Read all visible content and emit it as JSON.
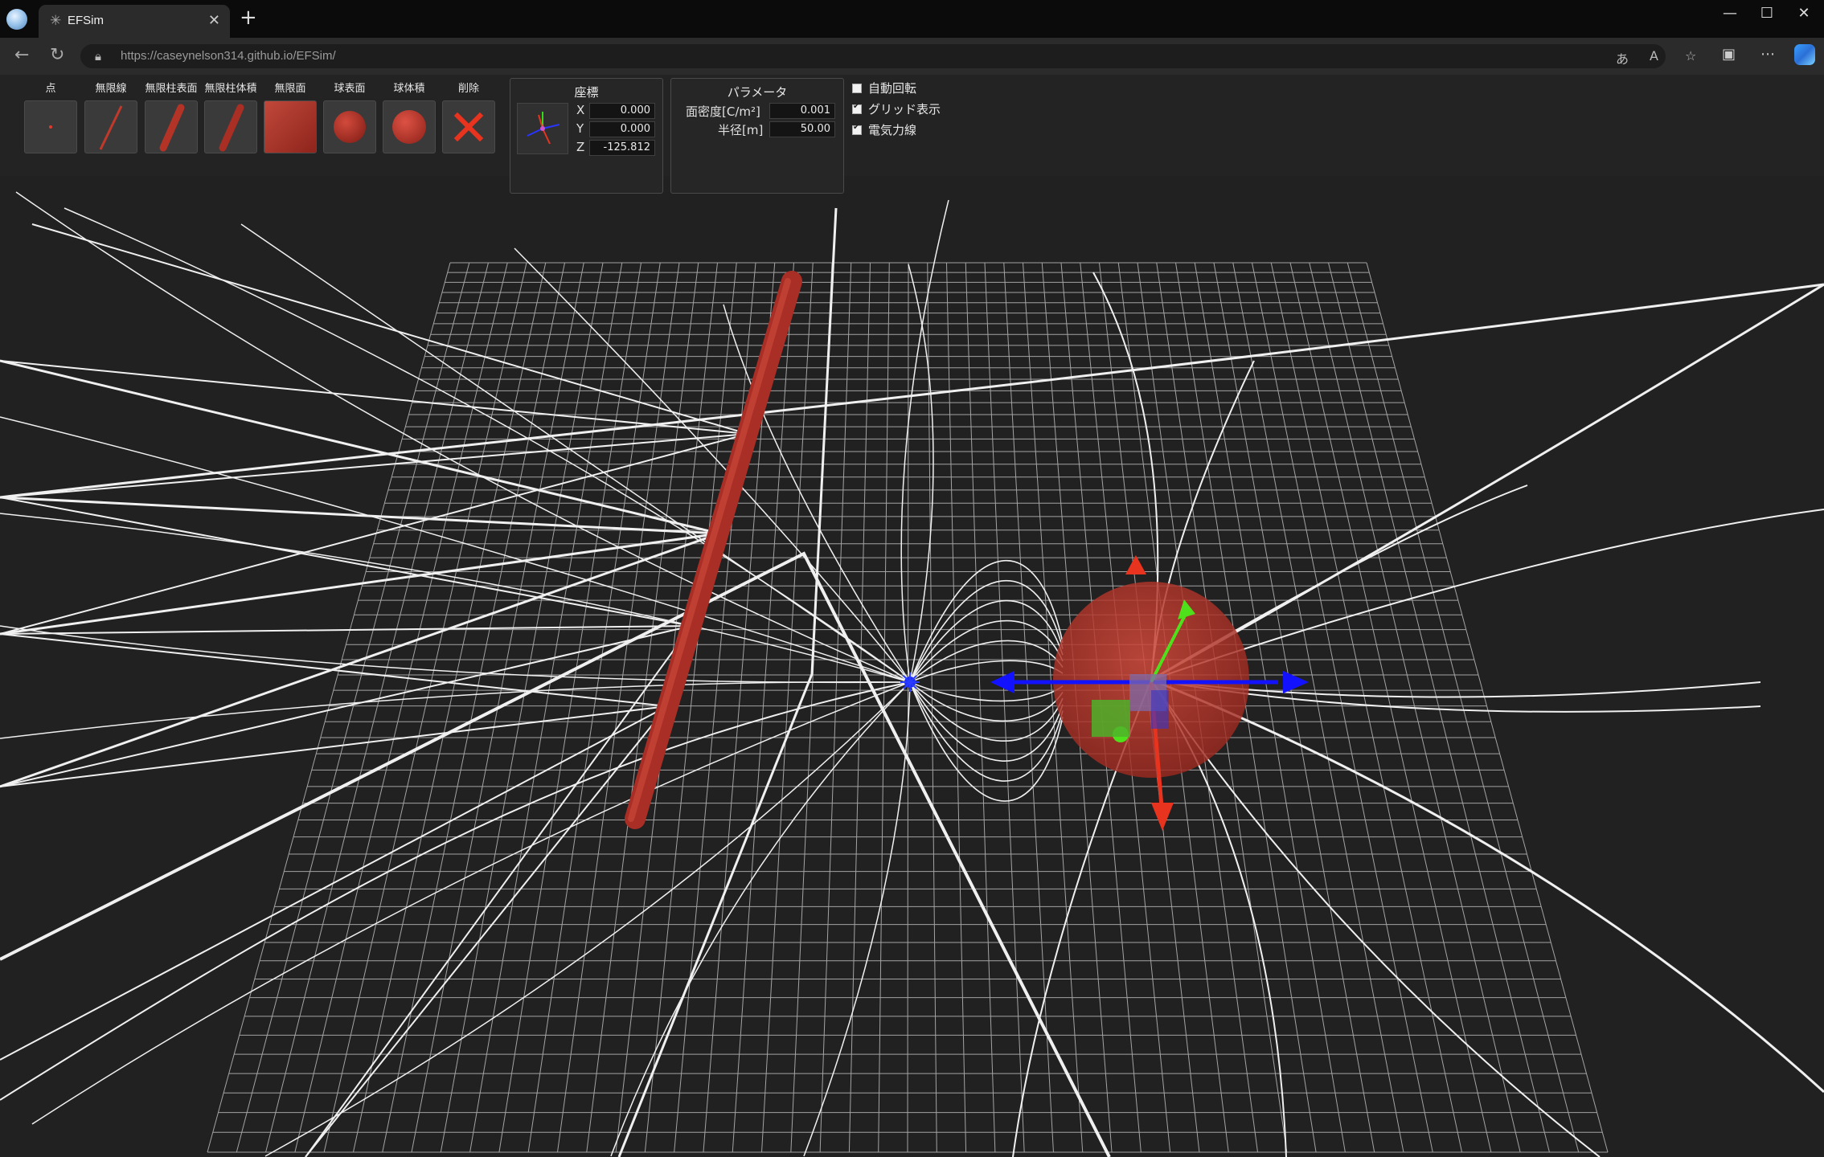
{
  "browser": {
    "tab_title": "EFSim",
    "tab_favicon_icon": "sim-favicon-icon",
    "url_host": "https://caseynelson314.github.io",
    "url_path": "/EFSim/",
    "window_controls": {
      "minimize": "—",
      "maximize": "☐",
      "close": "✕"
    }
  },
  "toolbar": {
    "tools": [
      {
        "label": "点",
        "icon": "point-charge-icon"
      },
      {
        "label": "無限線",
        "icon": "infinite-line-icon"
      },
      {
        "label": "無限柱表面",
        "icon": "cylinder-surface-icon"
      },
      {
        "label": "無限柱体積",
        "icon": "cylinder-volume-icon"
      },
      {
        "label": "無限面",
        "icon": "infinite-plane-icon"
      },
      {
        "label": "球表面",
        "icon": "sphere-surface-icon"
      },
      {
        "label": "球体積",
        "icon": "sphere-volume-icon"
      },
      {
        "label": "削除",
        "icon": "delete-icon"
      }
    ]
  },
  "coordinates": {
    "title": "座標",
    "x_label": "X",
    "x_value": "0.000",
    "y_label": "Y",
    "y_value": "0.000",
    "z_label": "Z",
    "z_value": "-125.812"
  },
  "parameters": {
    "title": "パラメータ",
    "density_label": "面密度[C/m²]",
    "density_value": "0.001",
    "radius_label": "半径[m]",
    "radius_value": "50.00"
  },
  "options": {
    "auto_rotate": {
      "label": "自動回転",
      "checked": false
    },
    "grid": {
      "label": "グリッド表示",
      "checked": true
    },
    "field_lines": {
      "label": "電気力線",
      "checked": true
    }
  },
  "colors": {
    "charge_red": "#b8332b",
    "axis_x": "#1010ff",
    "axis_y": "#52e21f",
    "axis_z": "#e8331f",
    "field_line": "#f2f2f2",
    "grid": "#d8d8d8",
    "background": "#212121"
  }
}
